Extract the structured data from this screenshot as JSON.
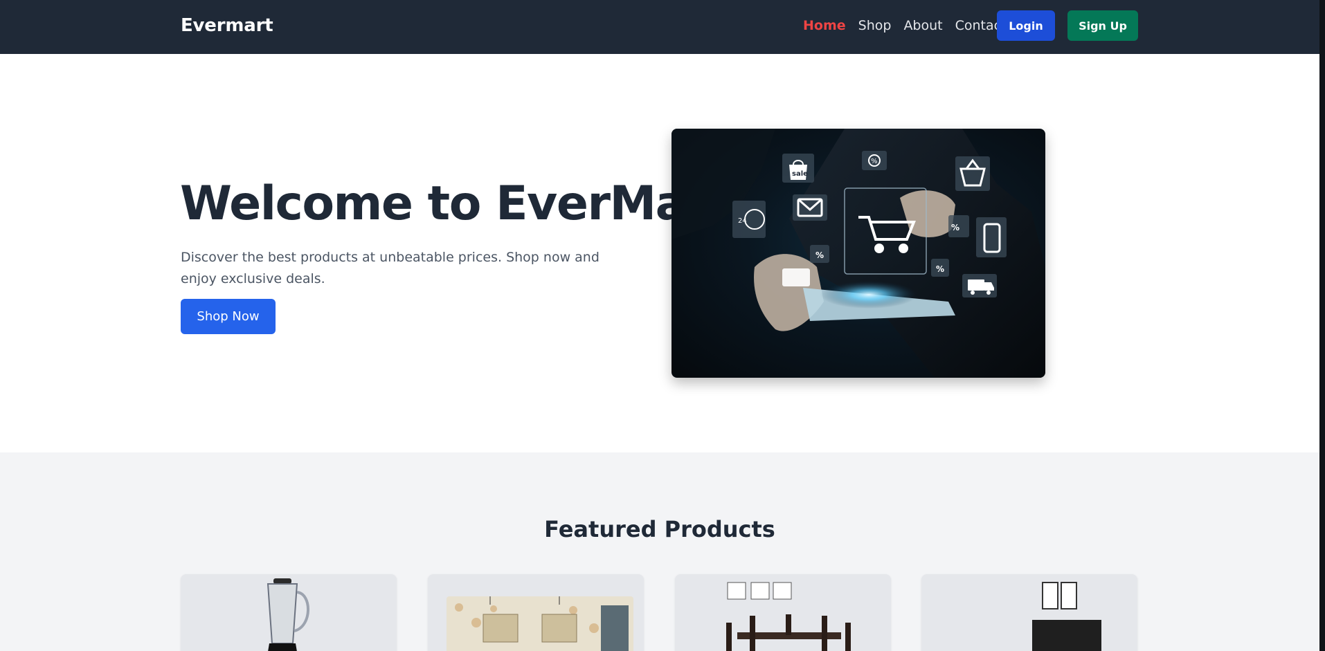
{
  "navbar": {
    "brand": "Evermart",
    "links": [
      {
        "label": "Home",
        "active": true
      },
      {
        "label": "Shop",
        "active": false
      },
      {
        "label": "About",
        "active": false
      },
      {
        "label": "Contact",
        "active": false
      }
    ],
    "login_label": "Login",
    "signup_label": "Sign Up"
  },
  "hero": {
    "title": "Welcome to EverMart",
    "description": "Discover the best products at unbeatable prices. Shop now and enjoy exclusive deals.",
    "cta_label": "Shop Now",
    "image_icons": [
      "sale-bag-icon",
      "percent-icon",
      "shopping-basket-icon",
      "envelope-icon",
      "cart-icon",
      "clock-24-icon",
      "mobile-phone-icon",
      "credit-card-icon",
      "delivery-truck-icon"
    ],
    "image_badge_sale": "sale",
    "image_badge_clock": "24"
  },
  "featured": {
    "title": "Featured Products",
    "products": [
      {
        "image": "blender-product-image"
      },
      {
        "image": "kitchen-product-image"
      },
      {
        "image": "dining-table-product-image"
      },
      {
        "image": "bed-product-image"
      }
    ]
  },
  "colors": {
    "navbar_bg": "#1f2937",
    "nav_active": "#ef4444",
    "login_bg": "#1d4ed8",
    "signup_bg": "#047857",
    "cta_bg": "#2563eb",
    "featured_bg": "#f3f4f6"
  }
}
